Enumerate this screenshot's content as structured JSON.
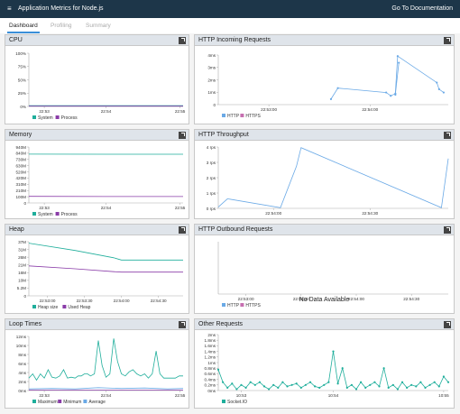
{
  "header": {
    "menu_glyph": "≡",
    "title": "Application Metrics for Node.js",
    "doc_link": "Go To Documentation"
  },
  "tabs": [
    {
      "label": "Dashboard"
    },
    {
      "label": "Profiling"
    },
    {
      "label": "Summary"
    }
  ],
  "colors": {
    "teal": "#1fae9b",
    "purple": "#8a3ca8",
    "blue": "#6aa9e6",
    "pink": "#c66fb0",
    "axis": "#aaaaaa",
    "bg": "#f4f4f4"
  },
  "panels": {
    "cpu": {
      "title": "CPU"
    },
    "incoming": {
      "title": "HTTP Incoming Requests"
    },
    "memory": {
      "title": "Memory"
    },
    "throughput": {
      "title": "HTTP Throughput"
    },
    "heap": {
      "title": "Heap"
    },
    "outbound": {
      "title": "HTTP Outbound Requests",
      "no_data": "No Data Available"
    },
    "loop": {
      "title": "Loop Times"
    },
    "other": {
      "title": "Other Requests"
    }
  },
  "chart_data": [
    {
      "id": "cpu",
      "type": "line",
      "x_ticks": [
        "22:53",
        "22:54",
        "22:55"
      ],
      "y_ticks": [
        "0%",
        "25%",
        "50%",
        "75%",
        "100%"
      ],
      "ylim": [
        0,
        100
      ],
      "legend": [
        "System",
        "Process"
      ],
      "series": [
        {
          "name": "System",
          "color": "#1fae9b",
          "x": [
            0,
            0.5,
            1,
            1.5,
            2
          ],
          "y": [
            1.5,
            1.5,
            1.5,
            1.5,
            1.5
          ]
        },
        {
          "name": "Process",
          "color": "#8a3ca8",
          "x": [
            0,
            0.5,
            1,
            1.5,
            2
          ],
          "y": [
            0.5,
            0.5,
            0.5,
            0.5,
            0.5
          ]
        }
      ]
    },
    {
      "id": "incoming",
      "type": "line",
      "x_ticks": [
        "22:53:00",
        "22:54:00"
      ],
      "y_ticks": [
        "0",
        "1ms",
        "2ms",
        "3ms",
        "4ms"
      ],
      "ylim": [
        0,
        4.5
      ],
      "legend": [
        "HTTP",
        "HTTPS"
      ],
      "series": [
        {
          "name": "HTTP",
          "color": "#6aa9e6",
          "x": [
            0.49,
            0.52,
            0.73,
            0.75,
            0.77,
            0.78,
            0.95,
            0.96,
            0.98
          ],
          "y": [
            0.5,
            1.5,
            1.1,
            0.8,
            1.0,
            4.4,
            2.0,
            1.4,
            1.1
          ]
        },
        {
          "name": "",
          "color": "#6aa9e6",
          "x": [
            0.77,
            0.785
          ],
          "y": [
            0.9,
            3.8
          ]
        }
      ]
    },
    {
      "id": "memory",
      "type": "line",
      "x_ticks": [
        "22:53",
        "22:54",
        "22:55"
      ],
      "y_ticks": [
        "0",
        "100M",
        "210M",
        "310M",
        "420M",
        "520M",
        "630M",
        "730M",
        "840M",
        "940M"
      ],
      "ylim": [
        0,
        940
      ],
      "legend": [
        "System",
        "Process"
      ],
      "series": [
        {
          "name": "System",
          "color": "#1fae9b",
          "x": [
            0,
            1,
            2
          ],
          "y": [
            820,
            818,
            818
          ]
        },
        {
          "name": "Process",
          "color": "#8a3ca8",
          "x": [
            0,
            1,
            2
          ],
          "y": [
            110,
            108,
            108
          ]
        }
      ]
    },
    {
      "id": "throughput",
      "type": "line",
      "x_ticks": [
        "22:54:00",
        "22:54:30"
      ],
      "y_ticks": [
        "0 rps",
        "1 rps",
        "2 rps",
        "3 rps",
        "4 rps"
      ],
      "ylim": [
        0,
        4.8
      ],
      "series": [
        {
          "name": "",
          "color": "#6aa9e6",
          "x": [
            0,
            0.04,
            0.27,
            0.34,
            0.36,
            0.97,
            1.0
          ],
          "y": [
            0.1,
            0.75,
            0.05,
            3.3,
            4.75,
            0.05,
            3.9
          ]
        }
      ]
    },
    {
      "id": "heap",
      "type": "line",
      "x_ticks": [
        "22:53:00",
        "22:53:30",
        "22:54:00",
        "22:54:30"
      ],
      "y_ticks": [
        "0",
        "5.2M",
        "10M",
        "16M",
        "21M",
        "26M",
        "31M",
        "37M"
      ],
      "ylim": [
        0,
        37
      ],
      "legend": [
        "Heap size",
        "Used Heap"
      ],
      "series": [
        {
          "name": "Heap size",
          "color": "#1fae9b",
          "x": [
            0,
            0.3,
            0.55,
            0.6,
            1.0
          ],
          "y": [
            36,
            31,
            26,
            24.5,
            24.5
          ]
        },
        {
          "name": "Used Heap",
          "color": "#8a3ca8",
          "x": [
            0,
            0.3,
            0.55,
            0.6,
            1.0
          ],
          "y": [
            20.5,
            18.5,
            16.5,
            16.2,
            16.2
          ]
        }
      ]
    },
    {
      "id": "outbound",
      "type": "line",
      "x_ticks": [
        "22:53:00",
        "22:53:30",
        "22:54:00",
        "22:54:30"
      ],
      "y_ticks": [],
      "ylim": [
        0,
        1
      ],
      "legend": [
        "HTTP",
        "HTTPS"
      ],
      "series": []
    },
    {
      "id": "loop",
      "type": "line",
      "x_ticks": [
        "22:53",
        "22:54",
        "22:55"
      ],
      "y_ticks": [
        "0ms",
        "2ms",
        "4ms",
        "6ms",
        "8ms",
        "10ms",
        "12ms"
      ],
      "ylim": [
        0,
        13
      ],
      "legend": [
        "Maximum",
        "Minimum",
        "Average"
      ],
      "series": [
        {
          "name": "Maximum",
          "color": "#1fae9b",
          "x": [
            0,
            0.05,
            0.1,
            0.15,
            0.2,
            0.25,
            0.3,
            0.35,
            0.4,
            0.45,
            0.5,
            0.55,
            0.6,
            0.64,
            0.68,
            0.72,
            0.76,
            0.8,
            0.85,
            0.9,
            0.95,
            1.0,
            1.05,
            1.1,
            1.15,
            1.2,
            1.25,
            1.3,
            1.35,
            1.4,
            1.45,
            1.5,
            1.55,
            1.6,
            1.65,
            1.7,
            1.75,
            1.8,
            1.85,
            1.9,
            1.95,
            2.0
          ],
          "y": [
            3,
            4,
            2.5,
            4,
            3,
            5,
            3.2,
            3,
            3.5,
            5,
            3,
            3.2,
            3,
            3.5,
            3.5,
            4,
            4,
            3.5,
            4,
            12,
            6,
            3.2,
            4,
            12.5,
            7,
            4,
            3.5,
            4.5,
            5,
            4,
            3.5,
            4,
            3,
            4,
            9.5,
            4,
            3,
            3,
            3,
            3,
            3.5,
            3.5
          ]
        },
        {
          "name": "Minimum",
          "color": "#8a3ca8",
          "x": [
            0,
            1,
            2
          ],
          "y": [
            0.1,
            0.1,
            0.1
          ]
        },
        {
          "name": "Average",
          "color": "#6aa9e6",
          "x": [
            0,
            0.3,
            0.6,
            0.9,
            1.2,
            1.5,
            1.8,
            2.0
          ],
          "y": [
            0.4,
            0.5,
            0.4,
            0.7,
            0.5,
            0.6,
            0.4,
            0.5
          ]
        }
      ]
    },
    {
      "id": "other",
      "type": "line",
      "x_ticks": [
        "10:53",
        "10:54",
        "10:55"
      ],
      "y_ticks": [
        "0ms",
        "0.2ms",
        "0.4ms",
        "0.6ms",
        "0.8ms",
        "1ms",
        "1.2ms",
        "1.4ms",
        "1.6ms",
        "1.8ms",
        "2ms"
      ],
      "ylim": [
        0,
        2
      ],
      "legend": [
        "Socket.IO"
      ],
      "series": [
        {
          "name": "Socket.IO",
          "color": "#1fae9b",
          "markers": true,
          "x": [
            0,
            0.04,
            0.08,
            0.12,
            0.16,
            0.2,
            0.24,
            0.28,
            0.32,
            0.36,
            0.4,
            0.44,
            0.48,
            0.52,
            0.56,
            0.6,
            0.64,
            0.68,
            0.72,
            0.76,
            0.8,
            0.84,
            0.88,
            0.92,
            0.96,
            1.0,
            1.04,
            1.08,
            1.12,
            1.16,
            1.2,
            1.24,
            1.28,
            1.32,
            1.36,
            1.4,
            1.44,
            1.48,
            1.52,
            1.56,
            1.6,
            1.64,
            1.68,
            1.72,
            1.76,
            1.8,
            1.84,
            1.88,
            1.92,
            1.96,
            2.0
          ],
          "y": [
            0.75,
            0.3,
            0.1,
            0.25,
            0.05,
            0.2,
            0.1,
            0.3,
            0.2,
            0.3,
            0.15,
            0.05,
            0.2,
            0.1,
            0.3,
            0.15,
            0.2,
            0.25,
            0.1,
            0.2,
            0.3,
            0.15,
            0.1,
            0.2,
            0.3,
            1.4,
            0.25,
            0.8,
            0.1,
            0.2,
            0.05,
            0.3,
            0.1,
            0.2,
            0.3,
            0.15,
            0.8,
            0.1,
            0.2,
            0.05,
            0.3,
            0.1,
            0.2,
            0.15,
            0.3,
            0.1,
            0.2,
            0.3,
            0.15,
            0.5,
            0.3
          ]
        }
      ]
    }
  ]
}
